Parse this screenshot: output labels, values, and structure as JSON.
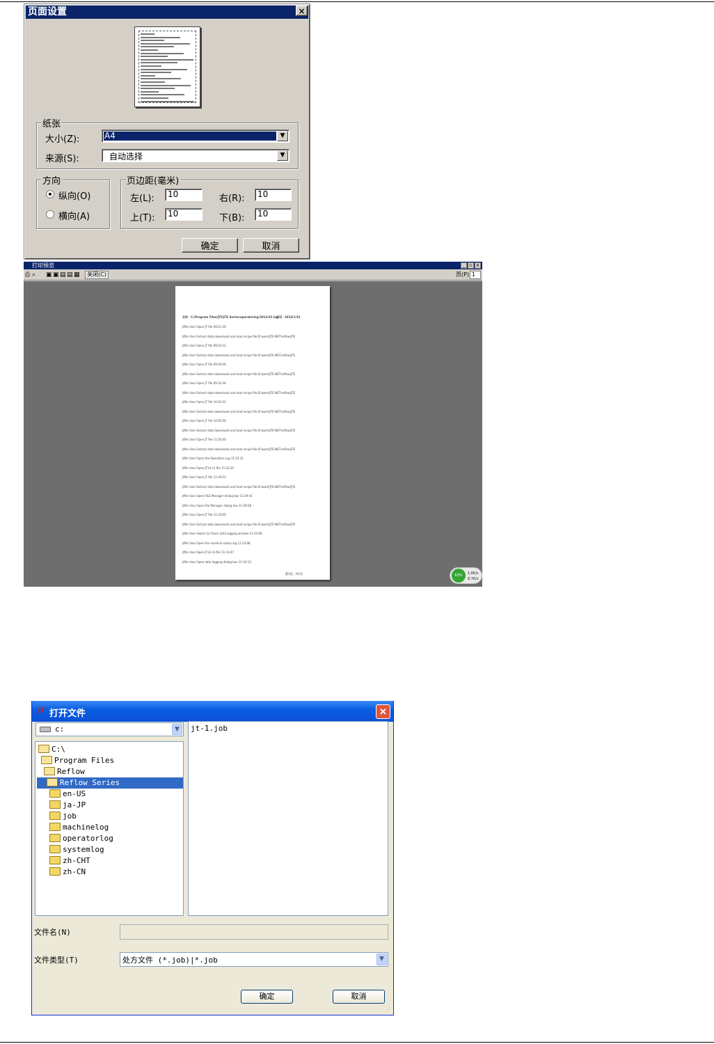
{
  "page_setup": {
    "title": "页面设置",
    "close": "×",
    "paper_group": "纸张",
    "size_label": "大小(Z):",
    "size_value": "A4",
    "source_label": "来源(S):",
    "source_value": "自动选择",
    "orientation_group": "方向",
    "portrait": "纵向(O)",
    "landscape": "横向(A)",
    "margins_group": "页边距(毫米)",
    "left_label": "左(L):",
    "left_value": "10",
    "right_label": "右(R):",
    "right_value": "10",
    "top_label": "上(T):",
    "top_value": "10",
    "bottom_label": "下(B):",
    "bottom_value": "10",
    "ok": "确定",
    "cancel": "取消"
  },
  "print_preview": {
    "title": "打印预览",
    "close_label": "关闭(C)",
    "page_label": "页(P)",
    "page_value": "1",
    "min": "_",
    "max": "▫",
    "close": "x",
    "doc_header": "文件：C:\\Program Files\\JTE\\JTE Series\\operatorlog\\2014-01.log",
    "doc_printed": "打印：2014/1/23",
    "doc_footer": "第1页，共1页",
    "log_rows": [
      "jtfile    User     Open JT file    08:21:26",
      "jtfile    User     Extract data downloads and load recipe file:D:\\work\\JTE-NET\\reflow\\JTE",
      "jtfile    User     Open JT file    08:22:32",
      "jtfile    User     Extract data downloads and load recipe file:D:\\work\\JTE-NET\\reflow\\JTE",
      "jtfile    User     Open JT file    09:29:46",
      "jtfile    User     Extract data downloads and load recipe file:D:\\work\\JTE-NET\\reflow\\JTE",
      "jtfile    User     Open JT file    09:31:26",
      "jtfile    User     Extract data downloads and load recipe file:D:\\work\\JTE-NET\\reflow\\JTE",
      "jtfile    User     Open JT file    10:03:32",
      "jtfile    User     Extract data downloads and load recipe file:D:\\work\\JTE-NET\\reflow\\JTE",
      "jtfile    User     Open JT file    10:05:56",
      "jtfile    User     Extract data downloads and load recipe file:D:\\work\\JTE-NET\\reflow\\JTE",
      "jtfile    User     Open JT file    11:20:40",
      "jtfile    User     Extract data downloads and load recipe file:D:\\work\\JTE-NET\\reflow\\JTE",
      "jtfile    User     Open the Operation Log    11:23:11",
      "jtfile    User     Open JT-k1-t1 file    11:23:25",
      "jtfile    User     Open JT file    11:29:21",
      "jtfile    User     Extract data downloads and load recipe file:D:\\work\\JTE-NET\\reflow\\JTE",
      "jtfile    User     Open FILE Manager dialog box    11:29:41",
      "jtfile    User     Open File Manager dialog box    11:29:58",
      "jtfile    User     Open JT file    11:33:00",
      "jtfile    User     Extract data downloads and load recipe file:D:\\work\\JTE-NET\\reflow\\JTE",
      "jtfile    User     Switch to Check data logging window    11:33:06",
      "jtfile    User     Open the machine status log    11:33:08",
      "jtfile    User     Open JT-k1-t3 file    11:33:47",
      "jtfile    User     Open data logging dialog box    11:34:13"
    ],
    "widget_pct": "63%",
    "widget_up": "1.6K/s",
    "widget_down": "8.7K/s"
  },
  "open_dialog": {
    "title": "打开文件",
    "app_logo": "JT",
    "close": "✕",
    "drive": "c:",
    "file_list": [
      "jt-1.job"
    ],
    "tree": [
      {
        "label": "C:\\",
        "level": 0,
        "open": true,
        "selected": false
      },
      {
        "label": "Program Files",
        "level": 1,
        "open": true,
        "selected": false
      },
      {
        "label": "Reflow",
        "level": 2,
        "open": true,
        "selected": false
      },
      {
        "label": "Reflow Series",
        "level": 3,
        "open": true,
        "selected": true
      },
      {
        "label": "en-US",
        "level": 4,
        "open": false,
        "selected": false
      },
      {
        "label": "ja-JP",
        "level": 4,
        "open": false,
        "selected": false
      },
      {
        "label": "job",
        "level": 4,
        "open": false,
        "selected": false
      },
      {
        "label": "machinelog",
        "level": 4,
        "open": false,
        "selected": false
      },
      {
        "label": "operatorlog",
        "level": 4,
        "open": false,
        "selected": false
      },
      {
        "label": "systemlog",
        "level": 4,
        "open": false,
        "selected": false
      },
      {
        "label": "zh-CHT",
        "level": 4,
        "open": false,
        "selected": false
      },
      {
        "label": "zh-CN",
        "level": 4,
        "open": false,
        "selected": false
      }
    ],
    "filename_label": "文件名(N)",
    "filename_value": "",
    "filetype_label": "文件类型(T)",
    "filetype_value": "处方文件 (*.job)|*.job",
    "ok": "确定",
    "cancel": "取消"
  }
}
